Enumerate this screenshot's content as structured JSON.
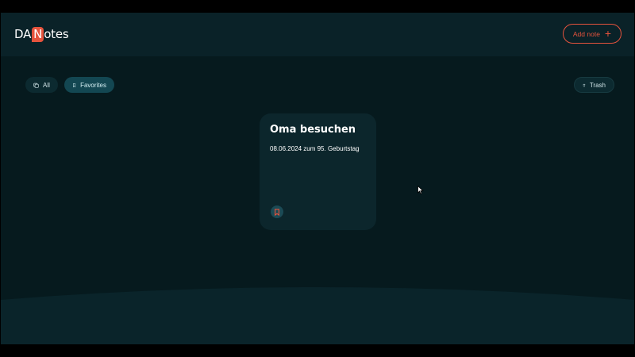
{
  "header": {
    "logo_prefix": "DA",
    "logo_badge": "N",
    "logo_suffix": "otes",
    "add_note_label": "Add note",
    "add_note_icon": "plus-icon"
  },
  "filters": {
    "all_label": "All",
    "all_icon": "notes-stack-icon",
    "favorites_label": "Favorites",
    "favorites_icon": "bookmark-icon",
    "active": "Favorites",
    "trash_label": "Trash",
    "trash_icon": "trash-icon"
  },
  "notes": [
    {
      "title": "Oma besuchen",
      "text": "08.06.2024 zum 95. Geburtstag",
      "favorite_icon": "bookmark-icon"
    }
  ],
  "colors": {
    "accent": "#e5533d",
    "background": "#061a1e",
    "header": "#0a2228",
    "card": "#0c262c",
    "active_filter": "#134752"
  }
}
